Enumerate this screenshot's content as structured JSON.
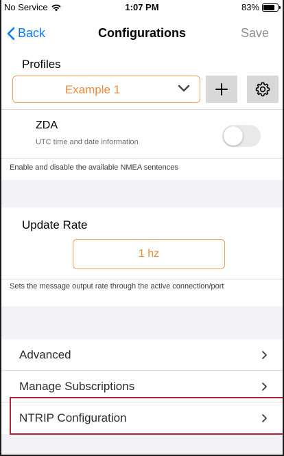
{
  "status_bar": {
    "carrier": "No Service",
    "time": "1:07 PM",
    "battery_text": "83%",
    "battery_level": 0.83
  },
  "nav": {
    "back_label": "Back",
    "title": "Configurations",
    "save_label": "Save"
  },
  "profiles": {
    "label": "Profiles",
    "selected": "Example 1"
  },
  "zda": {
    "title": "ZDA",
    "subtitle": "UTC time and date information",
    "enabled": false
  },
  "nmea_note": "Enable and disable the available NMEA sentences",
  "update_rate": {
    "title": "Update Rate",
    "value": "1 hz",
    "note": "Sets the message output rate through the active connection/port"
  },
  "menu": [
    {
      "label": "Advanced"
    },
    {
      "label": "Manage Subscriptions"
    },
    {
      "label": "NTRIP Configuration"
    }
  ],
  "colors": {
    "accent_blue": "#0a7aff",
    "accent_orange": "#ef8a3a",
    "highlight_red": "#b22234"
  }
}
